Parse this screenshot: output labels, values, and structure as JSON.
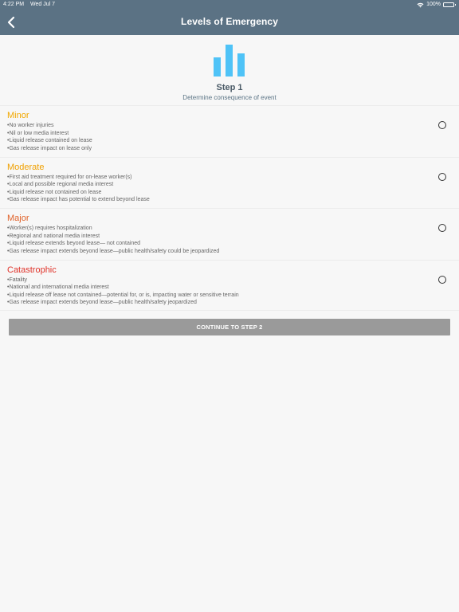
{
  "status_bar": {
    "time": "4:22 PM",
    "date": "Wed Jul 7",
    "battery": "100%"
  },
  "nav": {
    "title": "Levels of Emergency"
  },
  "step": {
    "title": "Step 1",
    "subtitle": "Determine consequence of event"
  },
  "levels": [
    {
      "name": "Minor",
      "color": "#f2a800",
      "lines": [
        "•No worker injuries",
        "•Nil or low media interest",
        "•Liquid release contained on lease",
        "•Gas release impact on lease only"
      ]
    },
    {
      "name": "Moderate",
      "color": "#f0a000",
      "lines": [
        "•First aid treatment required for on-lease worker(s)",
        "•Local and possible regional media interest",
        "•Liquid release not contained on lease",
        "•Gas release impact has potential to extend beyond lease"
      ]
    },
    {
      "name": "Major",
      "color": "#e0622a",
      "lines": [
        "•Worker(s) requires hospitalization",
        "•Regional and national media interest",
        "•Liquid release extends beyond lease— not contained",
        "•Gas release impact extends beyond lease—public health/safety could be jeopardized"
      ]
    },
    {
      "name": "Catastrophic",
      "color": "#e0332a",
      "lines": [
        "•Fatality",
        "•National and international media interest",
        "•Liquid release off lease not contained—potential for, or is, impacting water or sensitive terrain",
        "•Gas release impact extends beyond lease—public health/safety jeopardized"
      ]
    }
  ],
  "continue_label": "CONTINUE TO STEP 2",
  "colors": {
    "header": "#5b7284",
    "accent_icon": "#4fc3f7",
    "button": "#9a9a9a"
  }
}
